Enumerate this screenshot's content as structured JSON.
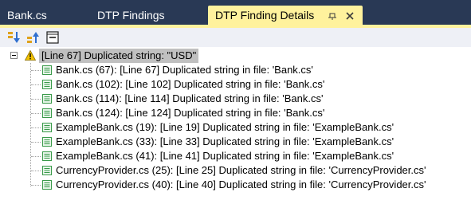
{
  "tabs": [
    {
      "label": "Bank.cs",
      "active": false
    },
    {
      "label": "DTP Findings",
      "active": false
    },
    {
      "label": "DTP Finding Details",
      "active": true,
      "pin_glyph": "⊣",
      "close_glyph": "✕"
    }
  ],
  "toolbar": {
    "buttons": [
      {
        "icon": "expand-all-icon"
      },
      {
        "icon": "collapse-up-icon"
      },
      {
        "icon": "collapse-all-icon"
      }
    ]
  },
  "tree": {
    "root": {
      "icon": "warning-icon",
      "label": "[Line 67] Duplicated string: \"USD\"",
      "expanded": true
    },
    "children": [
      {
        "label": "Bank.cs (67): [Line 67] Duplicated string in file: 'Bank.cs'"
      },
      {
        "label": "Bank.cs (102): [Line 102] Duplicated string in file: 'Bank.cs'"
      },
      {
        "label": "Bank.cs (114): [Line 114] Duplicated string in file: 'Bank.cs'"
      },
      {
        "label": "Bank.cs (124): [Line 124] Duplicated string in file: 'Bank.cs'"
      },
      {
        "label": "ExampleBank.cs (19): [Line 19] Duplicated string in file: 'ExampleBank.cs'"
      },
      {
        "label": "ExampleBank.cs (33): [Line 33] Duplicated string in file: 'ExampleBank.cs'"
      },
      {
        "label": "ExampleBank.cs (41): [Line 41] Duplicated string in file: 'ExampleBank.cs'"
      },
      {
        "label": "CurrencyProvider.cs (25): [Line 25] Duplicated string in file: 'CurrencyProvider.cs'"
      },
      {
        "label": "CurrencyProvider.cs (40): [Line 40] Duplicated string in file: 'CurrencyProvider.cs'"
      }
    ]
  },
  "colors": {
    "tab_strip": "#293955",
    "active_tab": "#fff29d",
    "selection": "#c0c0c0",
    "file_icon": "#3a9a4a",
    "warning": "#f2c200"
  }
}
